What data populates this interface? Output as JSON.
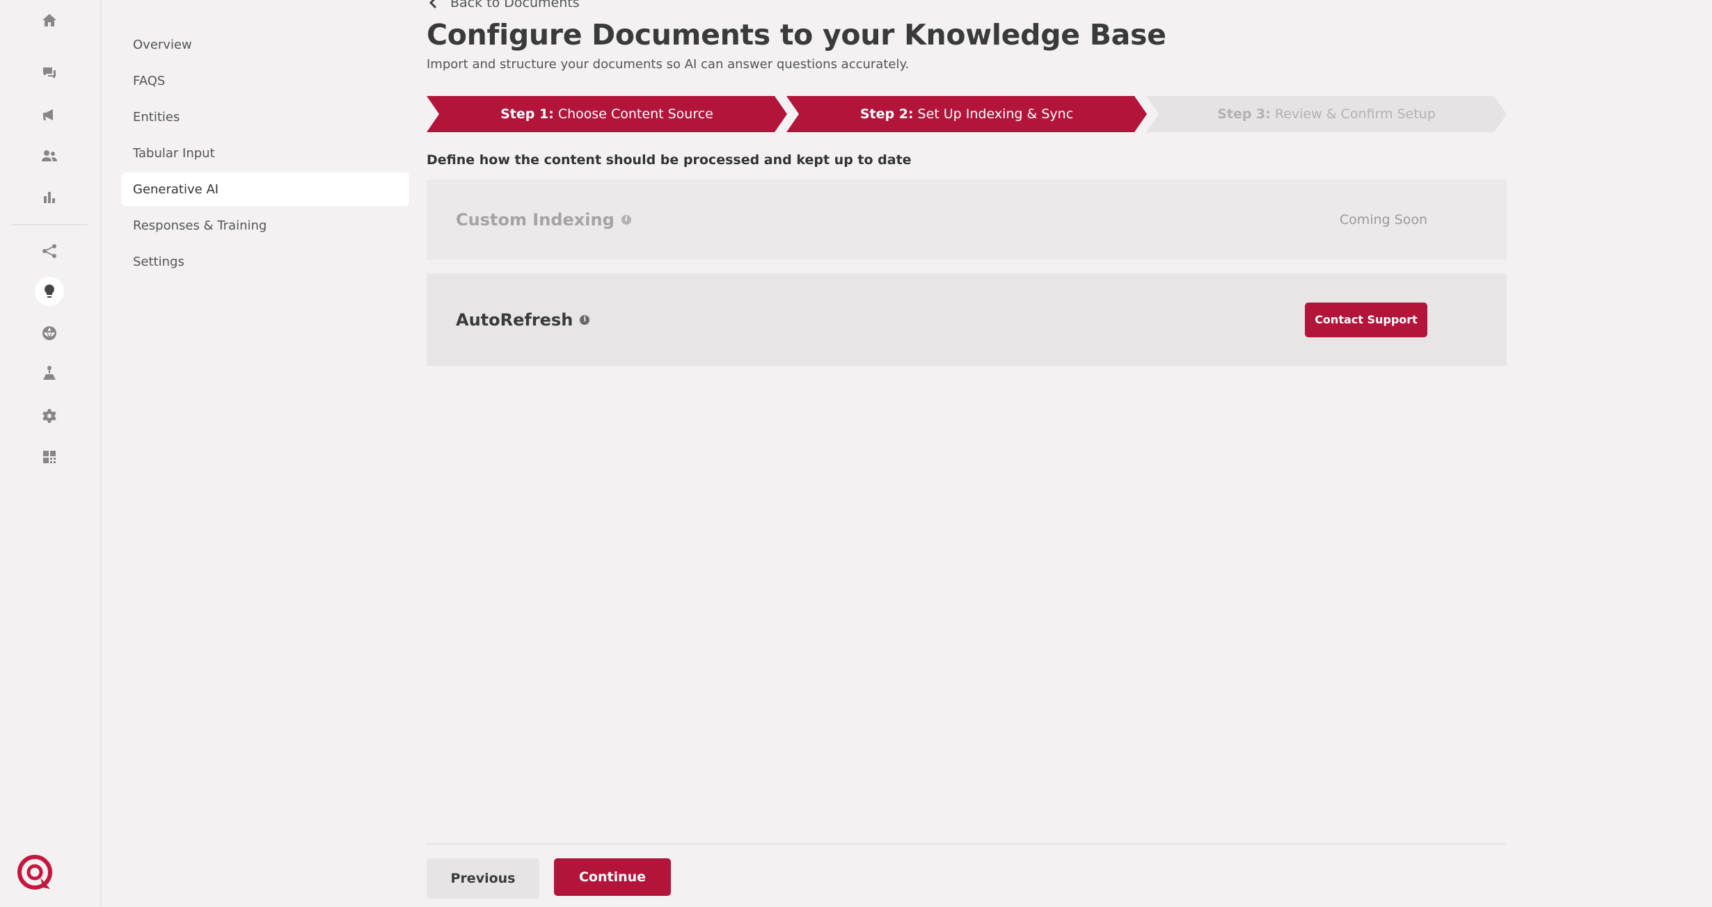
{
  "rail": {
    "icons": [
      "home-icon",
      "chat-icon",
      "megaphone-icon",
      "users-icon",
      "bar-chart-icon",
      "share-icon",
      "lightbulb-icon",
      "globe-icon",
      "hierarchy-icon",
      "gear-icon",
      "qr-grid-icon"
    ],
    "active_icon": "lightbulb-icon",
    "logo": "brand-logo-icon"
  },
  "subnav": {
    "items": [
      {
        "label": "Overview"
      },
      {
        "label": "FAQS"
      },
      {
        "label": "Entities"
      },
      {
        "label": "Tabular Input"
      },
      {
        "label": "Generative AI"
      },
      {
        "label": "Responses & Training"
      },
      {
        "label": "Settings"
      }
    ],
    "active": "Generative AI"
  },
  "main": {
    "back_label": "Back to Documents",
    "title": "Configure Documents to your Knowledge Base",
    "subtitle": "Import and structure your documents so AI can answer questions accurately.",
    "steps": [
      {
        "prefix": "Step 1:",
        "label": "Choose Content Source",
        "state": "complete"
      },
      {
        "prefix": "Step 2:",
        "label": "Set Up Indexing & Sync",
        "state": "current"
      },
      {
        "prefix": "Step 3:",
        "label": "Review & Confirm Setup",
        "state": "upcoming"
      }
    ],
    "section_heading": "Define how the content should be processed and kept up to date",
    "cards": {
      "custom_indexing": {
        "title": "Custom Indexing",
        "status": "Coming Soon"
      },
      "autorefresh": {
        "title": "AutoRefresh",
        "button": "Contact Support"
      }
    },
    "footer": {
      "previous": "Previous",
      "continue": "Continue"
    }
  },
  "colors": {
    "accent": "#b3143a",
    "background": "#f3f1f2",
    "card": "#e8e6e7"
  }
}
